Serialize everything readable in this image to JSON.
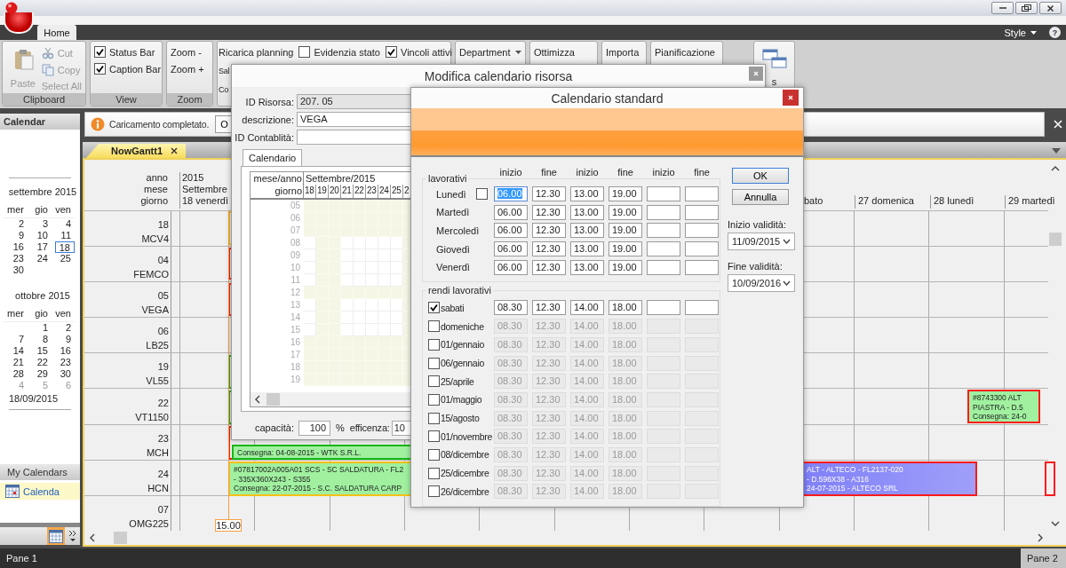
{
  "ribbon": {
    "tabs": [
      {
        "label": "Home",
        "selected": true
      }
    ],
    "style_menu": "Style",
    "help": "?",
    "groups": [
      {
        "label": "Clipboard",
        "items": [
          {
            "kind": "large",
            "text": "Paste",
            "disabled": true
          },
          {
            "kind": "small",
            "text": "Cut",
            "disabled": true
          },
          {
            "kind": "small",
            "text": "Copy",
            "disabled": true
          },
          {
            "kind": "small",
            "text": "Select All",
            "disabled": true
          }
        ]
      },
      {
        "label": "View",
        "items": [
          {
            "kind": "check",
            "text": "Status Bar",
            "checked": true
          },
          {
            "kind": "check",
            "text": "Caption Bar",
            "checked": true
          }
        ]
      },
      {
        "label": "Zoom",
        "items": [
          {
            "kind": "button",
            "text": "Zoom -"
          },
          {
            "kind": "button",
            "text": "Zoom +"
          }
        ]
      },
      {
        "items": [
          {
            "kind": "button",
            "text": "Ricarica planning"
          },
          {
            "kind": "check",
            "text": "Evidenzia stato",
            "checked": false
          },
          {
            "kind": "check",
            "text": "Vincoli attivi",
            "checked": true
          },
          {
            "kind": "button",
            "text": "Sal"
          },
          {
            "kind": "button",
            "text": "Co"
          }
        ]
      },
      {
        "items": [
          {
            "kind": "dropdown",
            "text": "Department"
          }
        ]
      },
      {
        "items": [
          {
            "kind": "button",
            "text": "Ottimizza"
          }
        ]
      },
      {
        "items": [
          {
            "kind": "button",
            "text": "Importa"
          }
        ]
      },
      {
        "items": [
          {
            "kind": "button",
            "text": "Pianificazione"
          }
        ]
      },
      {
        "items": [
          {
            "kind": "large",
            "text": "s",
            "disabled": false
          }
        ]
      }
    ]
  },
  "calendar_pane": {
    "title": "Calendar",
    "months": [
      {
        "title": "settembre 2015",
        "weekdays": [
          "mer",
          "gio",
          "ven"
        ],
        "weeks": [
          [
            {
              "label": "2",
              "selected": false,
              "muted": false
            },
            {
              "label": "3",
              "selected": false,
              "muted": false
            },
            {
              "label": "4",
              "selected": false,
              "muted": false
            }
          ],
          [
            {
              "label": "9",
              "selected": false,
              "muted": false
            },
            {
              "label": "10",
              "selected": false,
              "muted": false
            },
            {
              "label": "11",
              "selected": false,
              "muted": false
            }
          ],
          [
            {
              "label": "16",
              "selected": false,
              "muted": false
            },
            {
              "label": "17",
              "selected": false,
              "muted": false
            },
            {
              "label": "18",
              "selected": true,
              "muted": false
            }
          ],
          [
            {
              "label": "23",
              "selected": false,
              "muted": false
            },
            {
              "label": "24",
              "selected": false,
              "muted": false
            },
            {
              "label": "25",
              "selected": false,
              "muted": false
            }
          ],
          [
            {
              "label": "30",
              "selected": false,
              "muted": false
            }
          ]
        ]
      },
      {
        "title": "ottobre 2015",
        "weekdays": [
          "mer",
          "gio",
          "ven"
        ],
        "weeks": [
          [
            {
              "label": "1",
              "selected": false,
              "muted": false
            },
            {
              "label": "2",
              "selected": false,
              "muted": false
            }
          ],
          [
            {
              "label": "7",
              "selected": false,
              "muted": false
            },
            {
              "label": "8",
              "selected": false,
              "muted": false
            },
            {
              "label": "9",
              "selected": false,
              "muted": false
            }
          ],
          [
            {
              "label": "14",
              "selected": false,
              "muted": false
            },
            {
              "label": "15",
              "selected": false,
              "muted": false
            },
            {
              "label": "16",
              "selected": false,
              "muted": false
            }
          ],
          [
            {
              "label": "21",
              "selected": false,
              "muted": false
            },
            {
              "label": "22",
              "selected": false,
              "muted": false
            },
            {
              "label": "23",
              "selected": false,
              "muted": false
            }
          ],
          [
            {
              "label": "28",
              "selected": false,
              "muted": false
            },
            {
              "label": "29",
              "selected": false,
              "muted": false
            },
            {
              "label": "30",
              "selected": false,
              "muted": false
            }
          ],
          [
            {
              "label": "4",
              "selected": false,
              "muted": true
            },
            {
              "label": "5",
              "selected": false,
              "muted": true
            },
            {
              "label": "6",
              "selected": false,
              "muted": true
            }
          ]
        ]
      }
    ],
    "date": "18/09/2015",
    "my_calendars": {
      "title": "My Calendars",
      "items": [
        {
          "label": "Calenda",
          "selected": true
        }
      ]
    }
  },
  "info_bar": {
    "message": "Caricamento completato.",
    "button": "O"
  },
  "document_tabs": [
    {
      "label": "NowGantt1",
      "selected": true
    }
  ],
  "gantt": {
    "header": [
      {
        "label": "anno",
        "value": "2015"
      },
      {
        "label": "mese",
        "value": "Settembre"
      },
      {
        "label": "giorno",
        "value": "18 venerdì"
      }
    ],
    "days": [
      "bato",
      "27 domenica",
      "28 lunedì",
      "29 martedì"
    ],
    "now_marker": "15.00",
    "rows": [
      {
        "number": "18",
        "name": "MCV4",
        "bars": [
          {
            "kind": "planned"
          }
        ]
      },
      {
        "number": "04",
        "name": "FEMCO",
        "bars": [
          {
            "kind": "late"
          }
        ]
      },
      {
        "number": "05",
        "name": "VEGA",
        "bars": [
          {
            "kind": "late"
          }
        ]
      },
      {
        "number": "06",
        "name": "LB25",
        "bars": []
      },
      {
        "number": "19",
        "name": "VL55",
        "bars": [
          {
            "kind": "on_time"
          }
        ]
      },
      {
        "number": "22",
        "name": "VT1150",
        "bars": [
          {
            "kind": "on_time"
          },
          {
            "kind": "late",
            "color": "#a0f0a0",
            "lines": [
              "#8743300 ALT",
              "PIASTRA - D.5",
              "Consegna: 24-0"
            ]
          }
        ]
      },
      {
        "number": "23",
        "name": "MCH",
        "bars": [
          {
            "kind": "late"
          },
          {
            "kind": "on_time",
            "color": "#a0f0a0",
            "lines": [
              "Consegna: 04-08-2015 - WTK S.R.L."
            ]
          }
        ]
      },
      {
        "number": "24",
        "name": "HCN",
        "bars": [
          {
            "kind": "planned",
            "color": "#a0f0a0",
            "lines": [
              "#07817002A005A01 SCS - SC SALDATURA - FL2",
              " - 335X360X243 - S355",
              "Consegna: 22-07-2015 - S.C. SALDATURA CARP"
            ]
          },
          {
            "kind": "late",
            "color": "#7f7ff8",
            "lines": [
              "ALT - ALTECO - FL2137-020",
              "- D.596X38 - A316",
              "24-07-2015 - ALTECO SRL"
            ]
          },
          {
            "kind": "late"
          }
        ]
      },
      {
        "number": "07",
        "name": "OMG225",
        "bars": []
      }
    ]
  },
  "resource_dialog": {
    "title": "Modifica calendario risorsa",
    "fields": [
      {
        "label": "ID Risorsa:",
        "value": "207. 05",
        "disabled": true
      },
      {
        "label": "descrizione:",
        "value": "VEGA",
        "disabled": false
      },
      {
        "label": "ID Contablità:",
        "disabled": false
      }
    ],
    "tabs": [
      {
        "label": "Calendario",
        "selected": true
      }
    ],
    "grid": {
      "month_label": "mese/anno",
      "month": "Settembre/2015",
      "day_label": "giorno",
      "days": [
        {
          "label": "18",
          "working": true
        },
        {
          "label": "19",
          "working": false
        },
        {
          "label": "20",
          "working": false
        },
        {
          "label": "21",
          "working": true
        },
        {
          "label": "22",
          "working": true
        },
        {
          "label": "23",
          "working": true
        },
        {
          "label": "24",
          "working": true
        },
        {
          "label": "25",
          "working": true
        },
        {
          "label": "2",
          "working": false
        }
      ],
      "hours": [
        {
          "label": "05",
          "working": false
        },
        {
          "label": "06",
          "working": false
        },
        {
          "label": "07",
          "working": false
        },
        {
          "label": "08",
          "working": true
        },
        {
          "label": "09",
          "working": true
        },
        {
          "label": "10",
          "working": true
        },
        {
          "label": "11",
          "working": true
        },
        {
          "label": "12",
          "working": false
        },
        {
          "label": "13",
          "working": true
        },
        {
          "label": "14",
          "working": true
        },
        {
          "label": "15",
          "working": true
        },
        {
          "label": "16",
          "working": false
        },
        {
          "label": "17",
          "working": false
        },
        {
          "label": "18",
          "working": false
        },
        {
          "label": "19",
          "working": false
        }
      ]
    },
    "capacity": {
      "label": "capacità:",
      "value": "100",
      "unit": "%"
    },
    "efficiency": {
      "label": "efficenza:",
      "value": "10"
    }
  },
  "standard_dialog": {
    "title": "Calendario standard",
    "columns": [
      "inizio",
      "fine",
      "inizio",
      "fine",
      "inizio",
      "fine"
    ],
    "workdays_title": "lavorativi",
    "workdays": [
      {
        "label": "Lunedì",
        "kind": "checkbox",
        "checked": false,
        "focused": true,
        "times": [
          "06.00",
          "12.30",
          "13.00",
          "19.00"
        ]
      },
      {
        "label": "Martedì",
        "kind": "plain",
        "focused": false,
        "times": [
          "06.00",
          "12.30",
          "13.00",
          "19.00"
        ]
      },
      {
        "label": "Mercoledì",
        "kind": "plain",
        "focused": false,
        "times": [
          "06.00",
          "12.30",
          "13.00",
          "19.00"
        ]
      },
      {
        "label": "Giovedì",
        "kind": "plain",
        "focused": false,
        "times": [
          "06.00",
          "12.30",
          "13.00",
          "19.00"
        ]
      },
      {
        "label": "Venerdì",
        "kind": "plain",
        "focused": false,
        "times": [
          "06.00",
          "12.30",
          "13.00",
          "19.00"
        ]
      }
    ],
    "extra_title": "rendi lavorativi",
    "extra_days": [
      {
        "label": "sabati",
        "checked": true,
        "times": [
          "08.30",
          "12.30",
          "14.00",
          "18.00"
        ]
      },
      {
        "label": "domeniche",
        "checked": false,
        "times": [
          "08.30",
          "12.30",
          "14.00",
          "18.00"
        ]
      },
      {
        "label": "01/gennaio",
        "checked": false,
        "times": [
          "08.30",
          "12.30",
          "14.00",
          "18.00"
        ]
      },
      {
        "label": "06/gennaio",
        "checked": false,
        "times": [
          "08.30",
          "12.30",
          "14.00",
          "18.00"
        ]
      },
      {
        "label": "25/aprile",
        "checked": false,
        "times": [
          "08.30",
          "12.30",
          "14.00",
          "18.00"
        ]
      },
      {
        "label": "01/maggio",
        "checked": false,
        "times": [
          "08.30",
          "12.30",
          "14.00",
          "18.00"
        ]
      },
      {
        "label": "15/agosto",
        "checked": false,
        "times": [
          "08.30",
          "12.30",
          "14.00",
          "18.00"
        ]
      },
      {
        "label": "01/novembre",
        "checked": false,
        "times": [
          "08.30",
          "12.30",
          "14.00",
          "18.00"
        ]
      },
      {
        "label": "08/dicembre",
        "checked": false,
        "times": [
          "08.30",
          "12.30",
          "14.00",
          "18.00"
        ]
      },
      {
        "label": "25/dicembre",
        "checked": false,
        "times": [
          "08.30",
          "12.30",
          "14.00",
          "18.00"
        ]
      },
      {
        "label": "26/dicembre",
        "checked": false,
        "times": [
          "08.30",
          "12.30",
          "14.00",
          "18.00"
        ]
      }
    ],
    "buttons": [
      "OK",
      "Annulla"
    ],
    "validity": [
      {
        "label": "Inizio validità:",
        "value": "11/09/2015"
      },
      {
        "label": "Fine validità:",
        "value": "10/09/2016"
      }
    ]
  },
  "status_bar": [
    "Pane 1",
    "Pane 2"
  ]
}
